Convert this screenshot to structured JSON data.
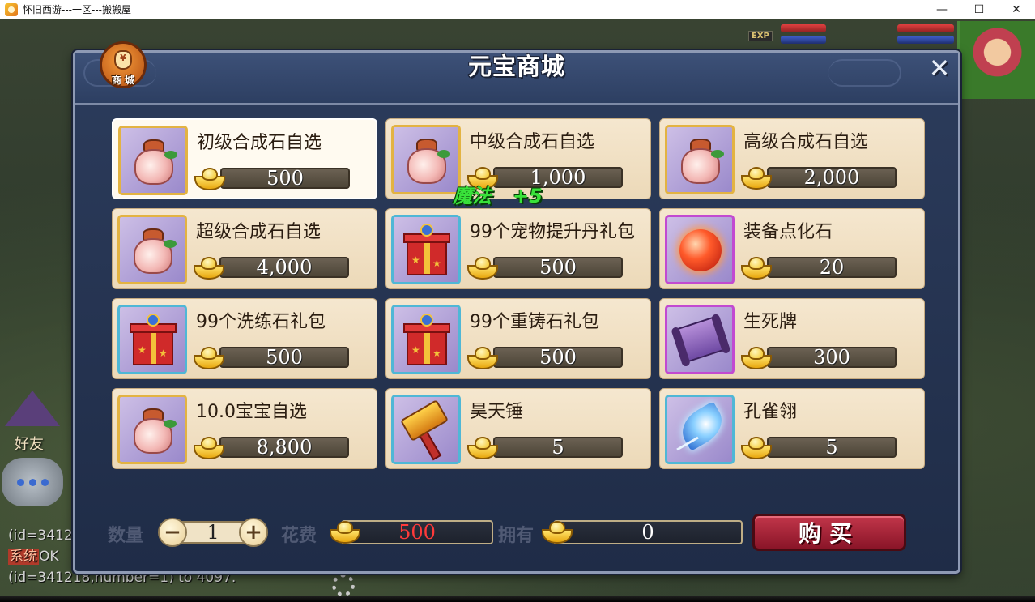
{
  "window": {
    "title": "怀旧西游---一区---搬搬屋",
    "minimize": "—",
    "maximize": "☐",
    "close": "✕"
  },
  "background": {
    "exp_tag": "EXP",
    "friend_label": "好友",
    "chat_lines": [
      "(id=3412",
      "OK",
      "(id=341218,number=1) to 4097."
    ],
    "system_tag": "系统"
  },
  "shop": {
    "title": "元宝商城",
    "badge_label": "商 城",
    "badge_symbol": "¥",
    "close_icon": "✕",
    "items": [
      {
        "name": "初级合成石自选",
        "price": "500",
        "icon": "bag-icon",
        "frame": "gold",
        "selected": true
      },
      {
        "name": "中级合成石自选",
        "price": "1,000",
        "icon": "bag-icon",
        "frame": "gold",
        "selected": false
      },
      {
        "name": "高级合成石自选",
        "price": "2,000",
        "icon": "bag-icon",
        "frame": "gold",
        "selected": false
      },
      {
        "name": "超级合成石自选",
        "price": "4,000",
        "icon": "bag-icon",
        "frame": "gold",
        "selected": false
      },
      {
        "name": "99个宠物提升丹礼包",
        "price": "500",
        "icon": "gift-icon",
        "frame": "blue",
        "selected": false
      },
      {
        "name": "装备点化石",
        "price": "20",
        "icon": "orb-icon",
        "frame": "purple",
        "selected": false
      },
      {
        "name": "99个洗练石礼包",
        "price": "500",
        "icon": "gift-icon",
        "frame": "blue",
        "selected": false
      },
      {
        "name": "99个重铸石礼包",
        "price": "500",
        "icon": "gift-icon",
        "frame": "blue",
        "selected": false
      },
      {
        "name": "生死牌",
        "price": "300",
        "icon": "scroll-icon",
        "frame": "purple",
        "selected": false
      },
      {
        "name": "10.0宝宝自选",
        "price": "8,800",
        "icon": "bag-icon",
        "frame": "gold",
        "selected": false
      },
      {
        "name": "昊天锤",
        "price": "5",
        "icon": "hammer-icon",
        "frame": "blue",
        "selected": false
      },
      {
        "name": "孔雀翎",
        "price": "5",
        "icon": "feather-icon",
        "frame": "blue",
        "selected": false
      }
    ],
    "popup": {
      "label": "魔法",
      "value": "+5"
    },
    "buy_bar": {
      "quantity_label": "数量",
      "quantity": "1",
      "minus": "−",
      "plus": "+",
      "cost_label": "花费",
      "cost": "500",
      "own_label": "拥有",
      "owned": "0",
      "buy_label": "购买"
    }
  },
  "colors": {
    "panel_bg": "#1f2c47",
    "card_bg": "#f5e7cf",
    "cost_red": "#ff3a3a",
    "buy_button": "#a52238",
    "popup_green": "#39e23a"
  }
}
